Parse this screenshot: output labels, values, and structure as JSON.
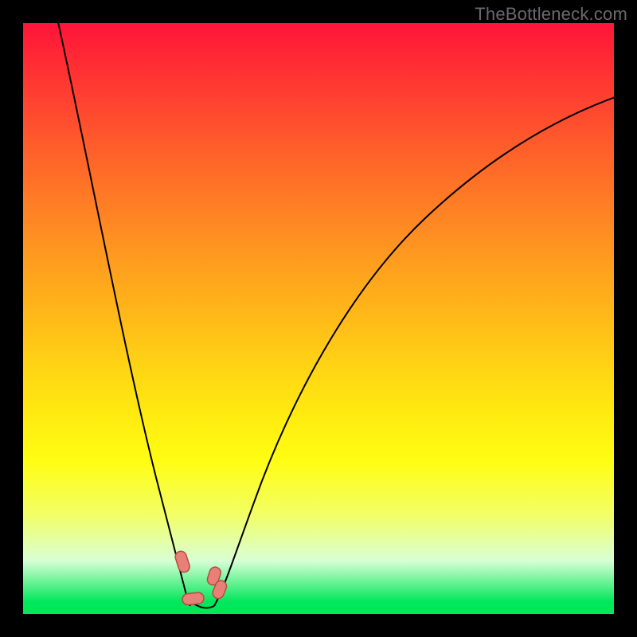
{
  "attribution": "TheBottleneck.com",
  "chart_data": {
    "type": "line",
    "title": "",
    "xlabel": "",
    "ylabel": "",
    "xlim": [
      0,
      100
    ],
    "ylim": [
      0,
      100
    ],
    "grid": false,
    "legend": false,
    "background_gradient": {
      "direction": "vertical",
      "stops": [
        {
          "pos": 0,
          "color": "#ff143a"
        },
        {
          "pos": 50,
          "color": "#ffc617"
        },
        {
          "pos": 80,
          "color": "#fcff3d"
        },
        {
          "pos": 100,
          "color": "#00e75a"
        }
      ]
    },
    "series": [
      {
        "name": "bottleneck-curve",
        "x": [
          5,
          10,
          15,
          20,
          24,
          27,
          29,
          30,
          31,
          33,
          36,
          42,
          50,
          60,
          72,
          85,
          100
        ],
        "y": [
          100,
          80,
          60,
          38,
          18,
          6,
          1,
          0,
          0,
          2,
          8,
          22,
          42,
          60,
          74,
          84,
          90
        ]
      }
    ],
    "markers": [
      {
        "x": 27,
        "y": 9
      },
      {
        "x": 29,
        "y": 2
      },
      {
        "x": 32,
        "y": 6
      },
      {
        "x": 33,
        "y": 4
      }
    ],
    "annotations": [
      {
        "text": "TheBottleneck.com",
        "position": "top-right"
      }
    ]
  }
}
